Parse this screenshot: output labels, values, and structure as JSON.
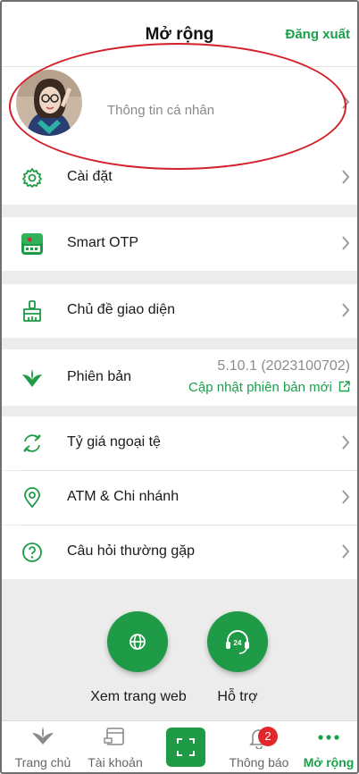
{
  "header": {
    "title": "Mở rộng",
    "logout": "Đăng xuất"
  },
  "profile": {
    "label": "Thông tin cá nhân"
  },
  "menu": {
    "settings": "Cài đặt",
    "smart_otp": "Smart OTP",
    "theme": "Chủ đề giao diện",
    "version": "Phiên bản",
    "version_number": "5.10.1 (2023100702)",
    "update_link": "Cập nhật phiên bản mới",
    "exchange_rate": "Tỷ giá ngoại tệ",
    "atm_branch": "ATM & Chi nhánh",
    "faq": "Câu hỏi thường gặp"
  },
  "actions": {
    "website": "Xem trang web",
    "support": "Hỗ trợ"
  },
  "tabs": {
    "home": "Trang chủ",
    "account": "Tài khoản",
    "notifications": "Thông báo",
    "more": "Mở rộng",
    "notification_count": "2"
  },
  "colors": {
    "brand_green": "#1aa04b",
    "badge_red": "#e2262a",
    "annotation_red": "#d3202a"
  },
  "icons": [
    "gear-icon",
    "smart-otp-icon",
    "brush-icon",
    "leaf-icon",
    "exchange-icon",
    "location-pin-icon",
    "question-icon",
    "globe-icon",
    "headset-24-icon",
    "scan-icon",
    "bell-icon",
    "more-dots-icon"
  ]
}
